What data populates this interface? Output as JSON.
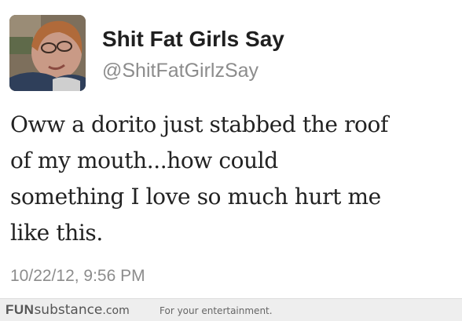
{
  "tweet": {
    "display_name": "Shit Fat Girls Say",
    "handle": "@ShitFatGirlzSay",
    "text_lines": [
      "Oww a dorito just stabbed the roof",
      "of my mouth...how could",
      "something I love so much hurt me",
      "like this."
    ],
    "timestamp": "10/22/12, 9:56 PM"
  },
  "footer": {
    "brand_bold": "FUN",
    "brand_main": "substance",
    "brand_suffix": ".com",
    "tagline": "For your entertainment."
  }
}
